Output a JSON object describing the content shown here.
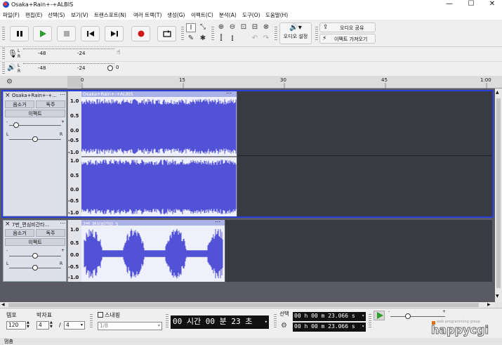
{
  "app": {
    "title": "Osaka+Rain+-+ALBIS",
    "menus": [
      "파일(F)",
      "편집(E)",
      "선택(S)",
      "보기(V)",
      "트랜스포트(N)",
      "여러 트랙(T)",
      "생성(G)",
      "이펙트(C)",
      "분석(A)",
      "도구(O)",
      "도움말(H)"
    ],
    "window_controls": {
      "minimize": "—",
      "maximize": "☐",
      "close": "✕"
    }
  },
  "toolbar": {
    "audio_setup_label": "오디오 설정",
    "share_audio_label": "오디오 공유",
    "get_effects_label": "이펙트 가져오기"
  },
  "meters": {
    "record_ticks": [
      "-48",
      "-24",
      "0"
    ],
    "play_ticks": [
      "-48",
      "-24",
      "0"
    ],
    "lr": [
      "L",
      "R"
    ]
  },
  "ruler": {
    "ticks": [
      "0",
      "15",
      "30",
      "45",
      "1:00"
    ]
  },
  "tracks": [
    {
      "name": "Osaka+Rain+-+...",
      "clip_name": "Osaka+Rain+-+ALBIS",
      "mute": "음소거",
      "solo": "독주",
      "effects": "이펙트",
      "stereo": true,
      "scale": [
        "1.0",
        "0.5",
        "0.0",
        "-0.5",
        "-1.0",
        "1.0",
        "0.5",
        "0.0",
        "-0.5",
        "-1.0"
      ],
      "selected": true
    },
    {
      "name": "7번_편심비간타...",
      "clip_name": "7번_편심비간타_5",
      "mute": "음소거",
      "solo": "독주",
      "effects": "이펙트",
      "stereo": false,
      "scale": [
        "1.0",
        "0.5",
        "0.0",
        "-0.5",
        "-1.0"
      ],
      "selected": false
    }
  ],
  "bottom": {
    "tempo_label": "템포",
    "tempo_value": "120",
    "time_sig_label": "박자표",
    "time_sig_num": "4",
    "time_sig_den": "4",
    "snap_label": "스내핑",
    "snap_value": "1/8",
    "time_display": "00 시간 00 분 23 초",
    "selection_label": "선택",
    "selection_start": "00 h 00 m 23.066 s",
    "selection_end": "00 h 00 m 23.066 s"
  },
  "status": {
    "text": "멈춤",
    "watermark": "happycgi",
    "watermark_sub": "web programming group"
  },
  "colors": {
    "waveform": "#5252d6",
    "waveform_bg": "#eef0fb",
    "selected_border": "#2a3cd9",
    "empty_track": "#3a3a42",
    "record_button": "#d01818",
    "play_button": "#2aa02a"
  }
}
